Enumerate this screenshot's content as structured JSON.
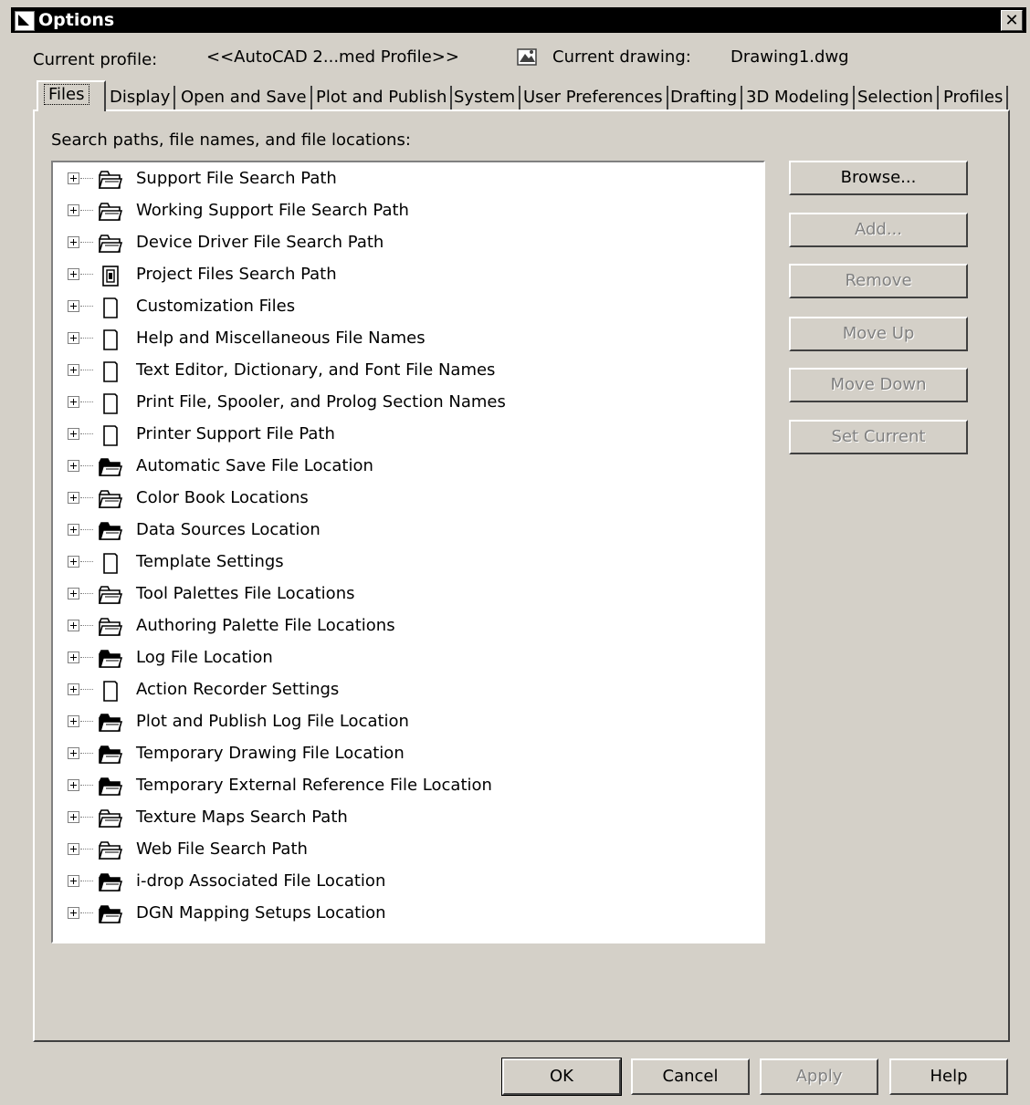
{
  "window": {
    "title": "Options",
    "close_glyph": "✕"
  },
  "profile": {
    "current_profile_label": "Current profile:",
    "current_profile_value": "<<AutoCAD 2...med Profile>>",
    "current_drawing_label": "Current drawing:",
    "current_drawing_value": "Drawing1.dwg"
  },
  "tabs": [
    {
      "label": "Files",
      "active": true
    },
    {
      "label": "Display"
    },
    {
      "label": "Open and Save"
    },
    {
      "label": "Plot and Publish"
    },
    {
      "label": "System"
    },
    {
      "label": "User Preferences"
    },
    {
      "label": "Drafting"
    },
    {
      "label": "3D Modeling"
    },
    {
      "label": "Selection"
    },
    {
      "label": "Profiles"
    }
  ],
  "files": {
    "section_label": "Search paths, file names, and file locations:",
    "tree_items": [
      {
        "label": "Support File Search Path",
        "icon": "folder-icon"
      },
      {
        "label": "Working Support File Search Path",
        "icon": "folder-icon"
      },
      {
        "label": "Device Driver File Search Path",
        "icon": "folder-icon"
      },
      {
        "label": "Project Files Search Path",
        "icon": "project-icon"
      },
      {
        "label": "Customization Files",
        "icon": "file-icon"
      },
      {
        "label": "Help and Miscellaneous File Names",
        "icon": "file-icon"
      },
      {
        "label": "Text Editor, Dictionary, and Font File Names",
        "icon": "file-icon"
      },
      {
        "label": "Print File, Spooler, and Prolog Section Names",
        "icon": "file-icon"
      },
      {
        "label": "Printer Support File Path",
        "icon": "file-icon"
      },
      {
        "label": "Automatic Save File Location",
        "icon": "folder-dark-icon"
      },
      {
        "label": "Color Book Locations",
        "icon": "folder-icon"
      },
      {
        "label": "Data Sources Location",
        "icon": "folder-dark-icon"
      },
      {
        "label": "Template Settings",
        "icon": "file-icon"
      },
      {
        "label": "Tool Palettes File Locations",
        "icon": "folder-icon"
      },
      {
        "label": "Authoring Palette File Locations",
        "icon": "folder-icon"
      },
      {
        "label": "Log File Location",
        "icon": "folder-dark-icon"
      },
      {
        "label": "Action Recorder Settings",
        "icon": "file-icon"
      },
      {
        "label": "Plot and Publish Log File Location",
        "icon": "folder-dark-icon"
      },
      {
        "label": "Temporary Drawing File Location",
        "icon": "folder-dark-icon"
      },
      {
        "label": "Temporary External Reference File Location",
        "icon": "folder-dark-icon"
      },
      {
        "label": "Texture Maps Search Path",
        "icon": "folder-icon"
      },
      {
        "label": "Web File Search Path",
        "icon": "folder-icon"
      },
      {
        "label": "i-drop Associated File Location",
        "icon": "folder-dark-icon"
      },
      {
        "label": "DGN Mapping Setups Location",
        "icon": "folder-dark-icon"
      }
    ],
    "buttons": {
      "browse": "Browse...",
      "add": "Add...",
      "remove": "Remove",
      "move_up": "Move Up",
      "move_down": "Move Down",
      "set_current": "Set Current"
    }
  },
  "footer": {
    "ok": "OK",
    "cancel": "Cancel",
    "apply": "Apply",
    "help": "Help"
  }
}
